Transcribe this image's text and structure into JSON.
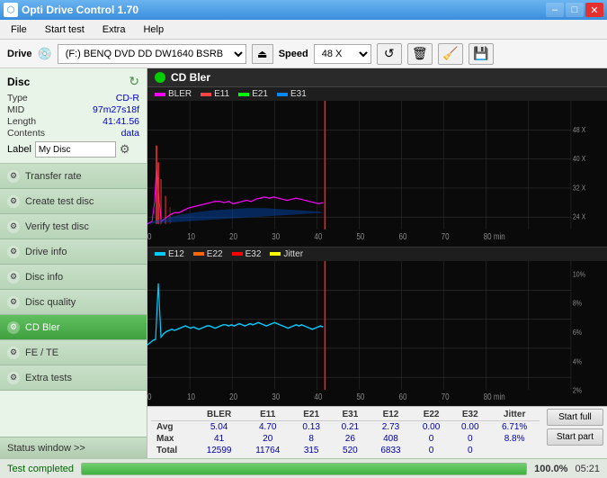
{
  "titleBar": {
    "title": "Opti Drive Control 1.70",
    "minLabel": "–",
    "maxLabel": "□",
    "closeLabel": "✕"
  },
  "menu": {
    "items": [
      "File",
      "Start test",
      "Extra",
      "Help"
    ]
  },
  "drive": {
    "label": "Drive",
    "driveValue": "(F:)  BENQ DVD DD DW1640 BSRB",
    "speedLabel": "Speed",
    "speedValue": "48 X"
  },
  "disc": {
    "title": "Disc",
    "type": {
      "label": "Type",
      "value": "CD-R"
    },
    "mid": {
      "label": "MID",
      "value": "97m27s18f"
    },
    "length": {
      "label": "Length",
      "value": "41:41.56"
    },
    "contents": {
      "label": "Contents",
      "value": "data"
    },
    "labelText": "Label",
    "labelValue": "My Disc"
  },
  "nav": {
    "items": [
      {
        "id": "transfer-rate",
        "label": "Transfer rate",
        "active": false
      },
      {
        "id": "create-test-disc",
        "label": "Create test disc",
        "active": false
      },
      {
        "id": "verify-test-disc",
        "label": "Verify test disc",
        "active": false
      },
      {
        "id": "drive-info",
        "label": "Drive info",
        "active": false
      },
      {
        "id": "disc-info",
        "label": "Disc info",
        "active": false
      },
      {
        "id": "disc-quality",
        "label": "Disc quality",
        "active": false
      },
      {
        "id": "cd-bler",
        "label": "CD Bler",
        "active": true
      },
      {
        "id": "fe-te",
        "label": "FE / TE",
        "active": false
      },
      {
        "id": "extra-tests",
        "label": "Extra tests",
        "active": false
      }
    ]
  },
  "statusWindow": "Status window >>",
  "chart1": {
    "title": "CD Bler",
    "legend": [
      {
        "label": "BLER",
        "color": "#ff00ff"
      },
      {
        "label": "E11",
        "color": "#ff4444"
      },
      {
        "label": "E21",
        "color": "#00ff00"
      },
      {
        "label": "E31",
        "color": "#0088ff"
      }
    ]
  },
  "chart2": {
    "legend": [
      {
        "label": "E12",
        "color": "#00ccff"
      },
      {
        "label": "E22",
        "color": "#ff6600"
      },
      {
        "label": "E32",
        "color": "#ff0000"
      },
      {
        "label": "Jitter",
        "color": "#ffff00"
      }
    ]
  },
  "stats": {
    "headers": [
      "",
      "BLER",
      "E11",
      "E21",
      "E31",
      "E12",
      "E22",
      "E32",
      "Jitter"
    ],
    "rows": [
      {
        "label": "Avg",
        "values": [
          "5.04",
          "4.70",
          "0.13",
          "0.21",
          "2.73",
          "0.00",
          "0.00",
          "6.71%"
        ]
      },
      {
        "label": "Max",
        "values": [
          "41",
          "20",
          "8",
          "26",
          "408",
          "0",
          "0",
          "8.8%"
        ]
      },
      {
        "label": "Total",
        "values": [
          "12599",
          "11764",
          "315",
          "520",
          "6833",
          "0",
          "0",
          ""
        ]
      }
    ],
    "startFull": "Start full",
    "startPart": "Start part"
  },
  "statusBar": {
    "text": "Test completed",
    "progress": 100,
    "pct": "100.0%",
    "time": "05:21"
  }
}
